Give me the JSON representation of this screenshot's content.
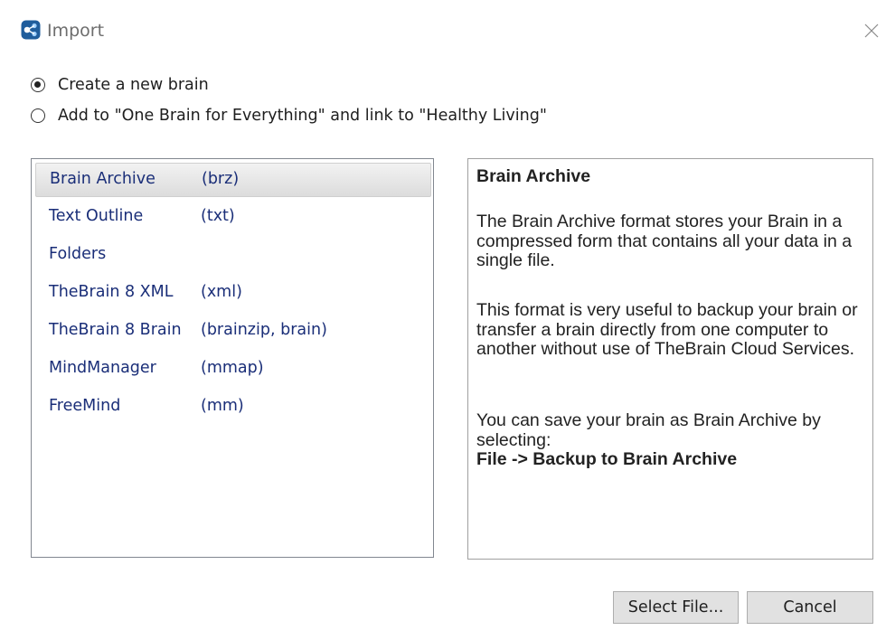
{
  "window": {
    "title": "Import",
    "app_icon": "thebrain-logo-icon",
    "close_icon": "close-icon"
  },
  "options": [
    {
      "label": "Create a new brain",
      "checked": true
    },
    {
      "label": "Add to \"One Brain for Everything\" and link to \"Healthy Living\"",
      "checked": false
    }
  ],
  "formats": [
    {
      "name": "Brain Archive",
      "ext": "(brz)",
      "selected": true
    },
    {
      "name": "Text Outline",
      "ext": "(txt)",
      "selected": false
    },
    {
      "name": "Folders",
      "ext": "",
      "selected": false
    },
    {
      "name": "TheBrain 8 XML",
      "ext": "(xml)",
      "selected": false
    },
    {
      "name": "TheBrain 8 Brain",
      "ext": "(brainzip, brain)",
      "selected": false
    },
    {
      "name": "MindManager",
      "ext": "(mmap)",
      "selected": false
    },
    {
      "name": "FreeMind",
      "ext": "(mm)",
      "selected": false
    }
  ],
  "description": {
    "title": "Brain Archive",
    "paragraph1": "The Brain Archive format stores your Brain in a compressed form that contains all your data in a single file.",
    "paragraph2": "This format is very useful to backup your brain or transfer a brain directly from one computer to another without use of TheBrain Cloud Services.",
    "paragraph3": "You can save your brain as Brain Archive by selecting:",
    "paragraph3_bold": "File -> Backup to Brain Archive"
  },
  "buttons": {
    "select_file": "Select File...",
    "cancel": "Cancel"
  },
  "colors": {
    "list_text": "#1a2e78",
    "title_text": "#6d6d6d",
    "button_bg": "#e1e1e1"
  }
}
